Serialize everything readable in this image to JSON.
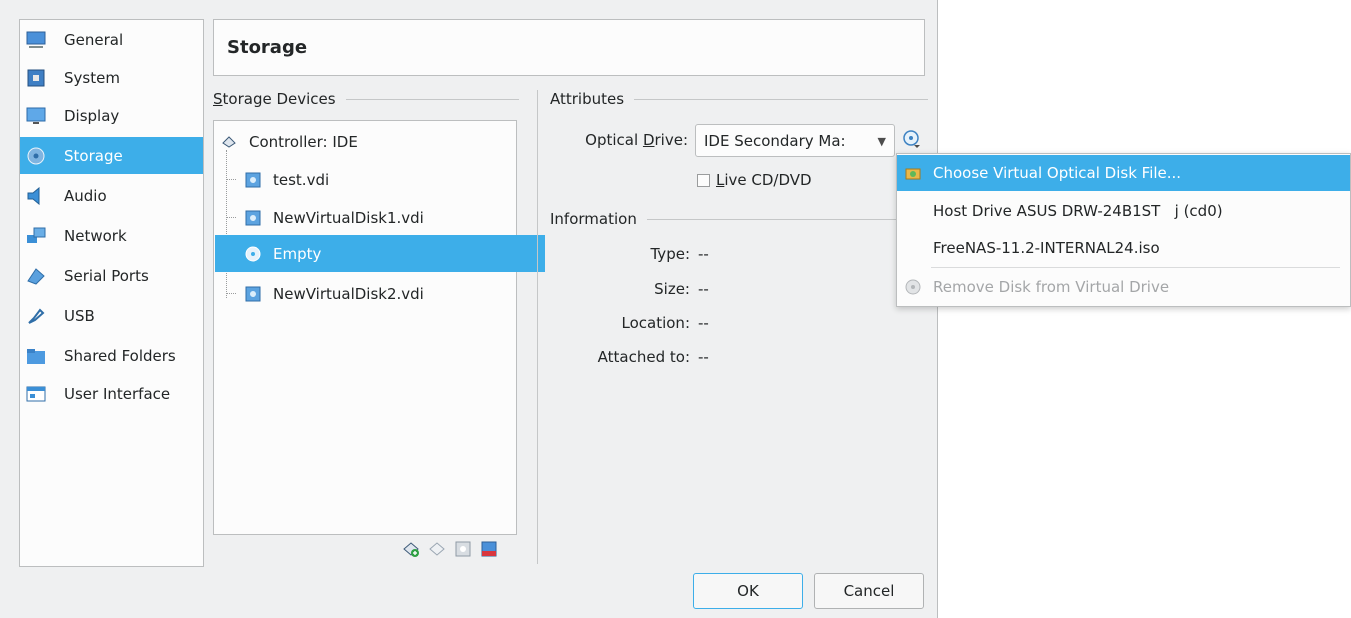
{
  "window": {
    "page_title": "Storage"
  },
  "sidebar": {
    "items": [
      {
        "label": "General",
        "icon": "general-icon",
        "selected": false
      },
      {
        "label": "System",
        "icon": "system-icon",
        "selected": false
      },
      {
        "label": "Display",
        "icon": "display-icon",
        "selected": false
      },
      {
        "label": "Storage",
        "icon": "storage-icon",
        "selected": true
      },
      {
        "label": "Audio",
        "icon": "audio-icon",
        "selected": false
      },
      {
        "label": "Network",
        "icon": "network-icon",
        "selected": false
      },
      {
        "label": "Serial Ports",
        "icon": "serial-ports-icon",
        "selected": false
      },
      {
        "label": "USB",
        "icon": "usb-icon",
        "selected": false
      },
      {
        "label": "Shared Folders",
        "icon": "shared-folders-icon",
        "selected": false
      },
      {
        "label": "User Interface",
        "icon": "user-interface-icon",
        "selected": false
      }
    ]
  },
  "storage_devices": {
    "group_label_prefix": "S",
    "group_label_rest": "torage Devices",
    "controller": {
      "label": "Controller: IDE"
    },
    "items": [
      {
        "label": "test.vdi",
        "type": "hard-disk",
        "selected": false
      },
      {
        "label": "NewVirtualDisk1.vdi",
        "type": "hard-disk",
        "selected": false
      },
      {
        "label": "Empty",
        "type": "optical",
        "selected": true
      },
      {
        "label": "NewVirtualDisk2.vdi",
        "type": "hard-disk",
        "selected": false
      }
    ]
  },
  "attributes": {
    "group_label": "Attributes",
    "optical_drive_label_a": "Optical ",
    "optical_drive_label_u": "D",
    "optical_drive_label_b": "rive:",
    "optical_drive_value": "IDE Secondary Ma:",
    "live_cd_u": "L",
    "live_cd_rest": "ive CD/DVD",
    "live_cd_checked": false
  },
  "information": {
    "group_label": "Information",
    "rows": [
      {
        "label": "Type:",
        "value": "--"
      },
      {
        "label": "Size:",
        "value": "--"
      },
      {
        "label": "Location:",
        "value": "--"
      },
      {
        "label": "Attached to:",
        "value": "--"
      }
    ]
  },
  "buttons": {
    "ok": "OK",
    "cancel": "Cancel"
  },
  "popup_menu": {
    "items": [
      {
        "label": "Choose Virtual Optical Disk File...",
        "icon": "folder-disk-icon",
        "highlight": true,
        "disabled": false
      },
      {
        "label": "Host Drive ASUS DRW-24B1ST   j (cd0)",
        "icon": "",
        "highlight": false,
        "disabled": false
      },
      {
        "label": "FreeNAS-11.2-INTERNAL24.iso",
        "icon": "",
        "highlight": false,
        "disabled": false
      },
      {
        "label": "Remove Disk from Virtual Drive",
        "icon": "remove-disk-icon",
        "highlight": false,
        "disabled": true
      }
    ]
  },
  "colors": {
    "selection": "#3daee9",
    "background": "#eff0f1"
  }
}
